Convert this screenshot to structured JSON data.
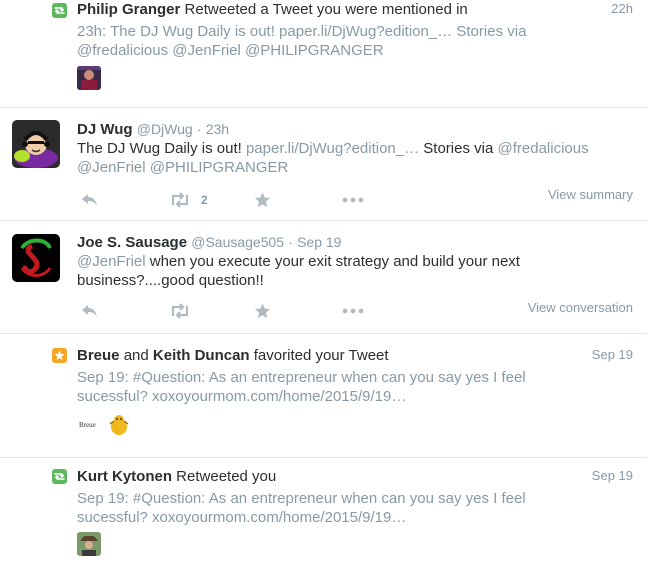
{
  "items": [
    {
      "actor": "Philip Granger",
      "action": "Retweeted a Tweet you were mentioned in",
      "time": "22h",
      "line1_prefix": "23h: The DJ Wug Daily is out! ",
      "line1_link": "paper.li/DjWug?edition_…",
      "line1_suffix": " Stories via",
      "line2_mention1": "@fredalicious",
      "line2_mention2": "@JenFriel",
      "line2_mention3": "@PHILIPGRANGER",
      "badge_icon": "retweet-icon"
    },
    {
      "name": "DJ Wug",
      "handle": "@DjWug",
      "dot": "·",
      "time": "23h",
      "text_prefix": "The DJ Wug Daily is out! ",
      "link": "paper.li/DjWug?edition_…",
      "text_mid": " Stories via ",
      "mention1": "@fredalicious",
      "mention2": "@JenFriel",
      "mention3": "@PHILIPGRANGER",
      "retweet_count": "2",
      "view_label": "View summary"
    },
    {
      "name": "Joe S. Sausage",
      "handle": "@Sausage505",
      "dot": "·",
      "time": "Sep 19",
      "mention": "@JenFriel",
      "text1": " when you execute your exit strategy and build your next",
      "text2": "business?....good question!!",
      "view_label": "View conversation"
    },
    {
      "actor1": "Breue",
      "and": "and",
      "actor2": "Keith Duncan",
      "action": "favorited your Tweet",
      "time": "Sep 19",
      "line1_prefix": "Sep 19: ",
      "hashtag": "#Question",
      "line1_rest": ": As an entrepreneur when can you say yes I feel",
      "line2": "sucessful?  xoxoyourmom.com/home/2015/9/19…",
      "badge_icon": "star-icon"
    },
    {
      "actor": "Kurt Kytonen",
      "action": "Retweeted you",
      "time": "Sep 19",
      "line1_prefix": "Sep 19: ",
      "hashtag": "#Question",
      "line1_rest": ": As an entrepreneur when can you say yes I feel",
      "line2": "sucessful?  xoxoyourmom.com/home/2015/9/19…",
      "badge_icon": "retweet-icon"
    }
  ],
  "colors": {
    "text": "#292f33",
    "muted": "#8899a6",
    "icon": "#b1bbc3",
    "retweet_badge": "#5cb85c",
    "favorite_badge": "#f5a623",
    "divider": "#e1e8ed"
  }
}
